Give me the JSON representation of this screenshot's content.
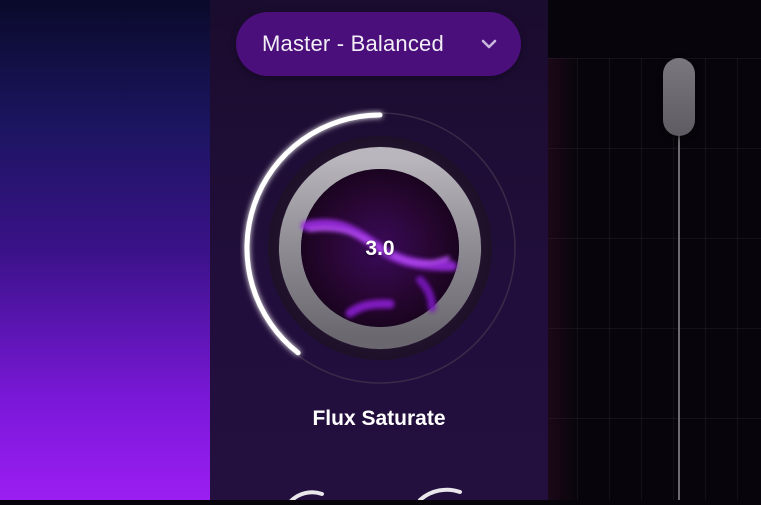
{
  "preset": {
    "label": "Master - Balanced",
    "icon": "chevron-down-icon"
  },
  "knob": {
    "value": "3.0",
    "label": "Flux Saturate",
    "level": 0.5
  },
  "slider": {
    "level": 0.92
  },
  "colors": {
    "accent": "#8a1fd0",
    "preset_bg": "#4a0f7a",
    "panel_bg": "#1a0c2e",
    "arc": "#ffffff"
  }
}
